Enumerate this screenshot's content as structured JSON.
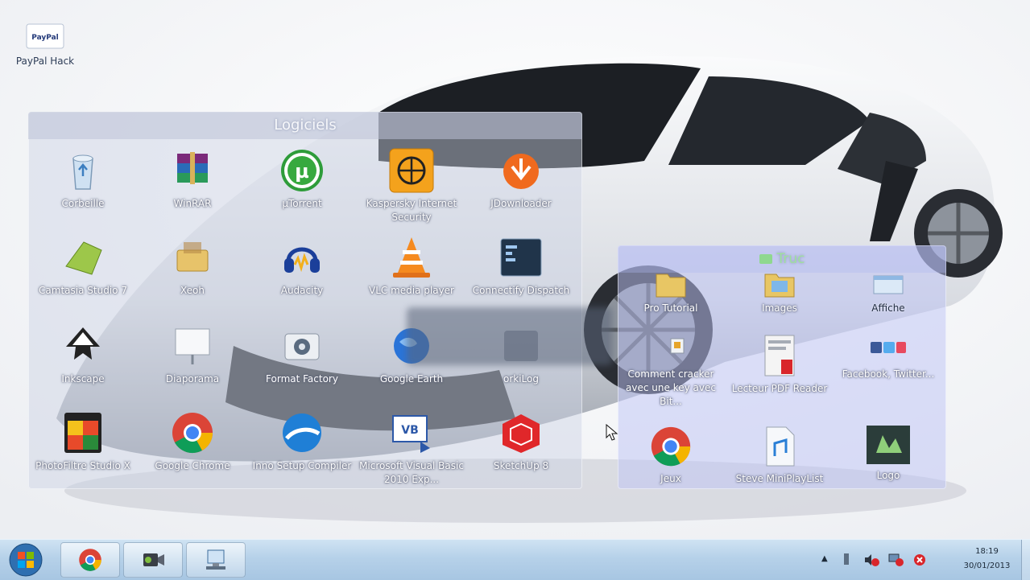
{
  "desktop": {
    "icons": [
      {
        "label": "PayPal Hack",
        "icon": "paypal-shortcut-icon",
        "badge": "PayPal"
      }
    ]
  },
  "fence_logiciels": {
    "title": "Logiciels",
    "items": [
      {
        "label": "Corbeille",
        "icon": "recycle-bin-icon"
      },
      {
        "label": "WinRAR",
        "icon": "winrar-icon"
      },
      {
        "label": "µTorrent",
        "icon": "utorrent-icon"
      },
      {
        "label": "Kaspersky Internet Security",
        "icon": "kaspersky-icon"
      },
      {
        "label": "JDownloader",
        "icon": "jdownloader-icon"
      },
      {
        "label": "Camtasia Studio 7",
        "icon": "camtasia-icon"
      },
      {
        "label": "Xeoh",
        "icon": "tools-folder-icon"
      },
      {
        "label": "Audacity",
        "icon": "audacity-icon"
      },
      {
        "label": "VLC media player",
        "icon": "vlc-icon"
      },
      {
        "label": "Connectify Dispatch",
        "icon": "app-window-icon"
      },
      {
        "label": "Inkscape",
        "icon": "inkscape-icon"
      },
      {
        "label": "Diaporama",
        "icon": "slideshow-icon"
      },
      {
        "label": "Format Factory",
        "icon": "format-factory-icon"
      },
      {
        "label": "Google Earth",
        "icon": "google-earth-icon"
      },
      {
        "label": "orkiLog",
        "icon": "hidden-app-icon"
      },
      {
        "label": "PhotoFiltre Studio X",
        "icon": "photofiltre-icon"
      },
      {
        "label": "Google Chrome",
        "icon": "chrome-icon"
      },
      {
        "label": "Inno Setup Compiler",
        "icon": "inno-setup-icon"
      },
      {
        "label": "Microsoft Visual Basic 2010 Exp...",
        "icon": "visual-basic-icon"
      },
      {
        "label": "SketchUp 8",
        "icon": "sketchup-icon"
      }
    ]
  },
  "fence_media": {
    "title": "Truc",
    "items": [
      {
        "label": "Pro Tutorial",
        "icon": "folder-icon"
      },
      {
        "label": "Images",
        "icon": "image-folder-icon"
      },
      {
        "label": "Affiche",
        "icon": "window-icon"
      },
      {
        "label": "Comment cracker avec une key avec Bit...",
        "icon": "text-doc-icon"
      },
      {
        "label": "Lecteur PDF Reader",
        "icon": "pdf-icon"
      },
      {
        "label": "Facebook, Twitter...",
        "icon": "social-icons-icon"
      },
      {
        "label": "Jeux",
        "icon": "chrome-icon"
      },
      {
        "label": "Steve MiniPlayList",
        "icon": "audio-file-icon"
      },
      {
        "label": "Logo",
        "icon": "logo-image-icon"
      }
    ]
  },
  "taskbar": {
    "start_icon": "windows-start-icon",
    "buttons": [
      {
        "name": "Google Chrome",
        "icon": "chrome-icon"
      },
      {
        "name": "Camtasia Recorder",
        "icon": "video-camera-icon"
      },
      {
        "name": "Network",
        "icon": "network-computer-icon"
      }
    ],
    "tray": {
      "time": "18:19",
      "date": "30/01/2013"
    }
  },
  "colors": {
    "taskbar_top": "#cfe3f3",
    "taskbar_bottom": "#a7c6e2",
    "fence_bg": "#cdd2e4",
    "media_fence_bg": "#bec4f5",
    "fence_title_media": "#9fe09f"
  }
}
